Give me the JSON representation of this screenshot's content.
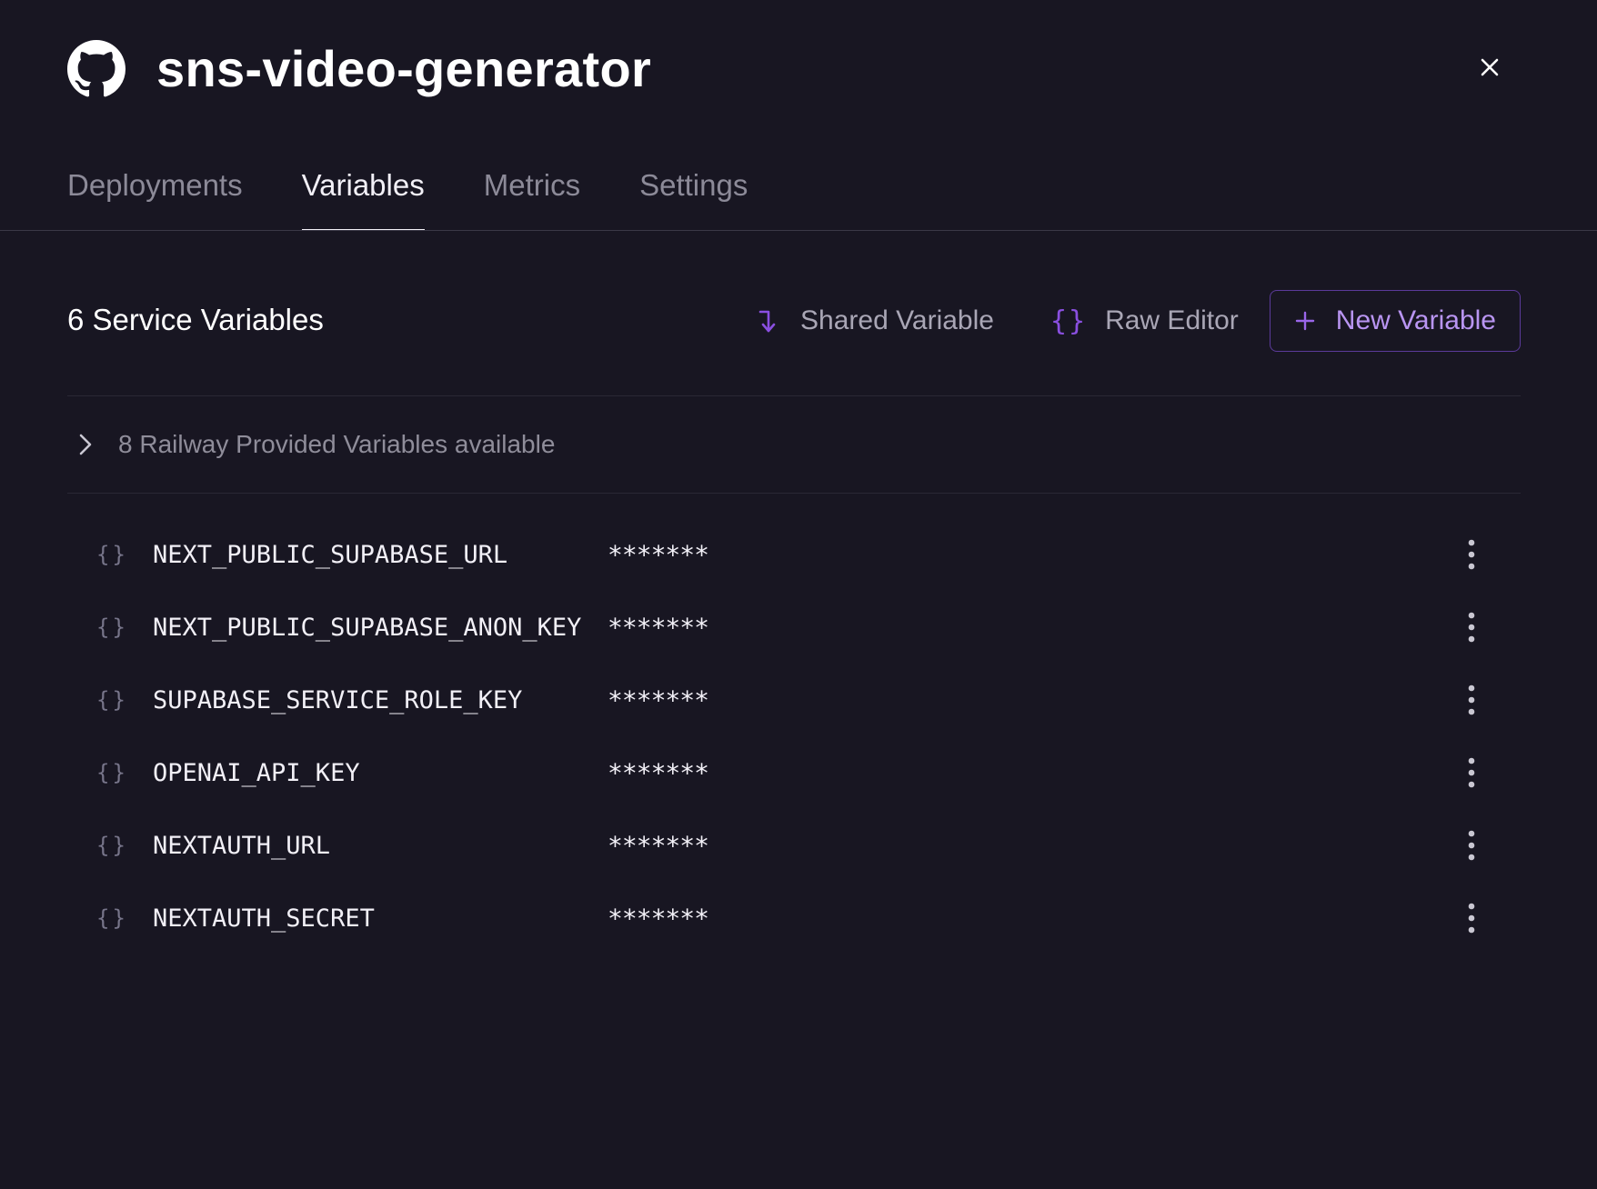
{
  "header": {
    "title": "sns-video-generator",
    "logo_icon": "github-icon",
    "close_icon": "close-icon"
  },
  "tabs": [
    {
      "label": "Deployments",
      "active": false
    },
    {
      "label": "Variables",
      "active": true
    },
    {
      "label": "Metrics",
      "active": false
    },
    {
      "label": "Settings",
      "active": false
    }
  ],
  "toolbar": {
    "section_title": "6 Service Variables",
    "shared_label": "Shared Variable",
    "shared_icon": "arrow-down-right-icon",
    "raw_label": "Raw Editor",
    "raw_icon": "braces-icon",
    "new_label": "New Variable",
    "new_icon": "plus-icon"
  },
  "provided": {
    "label": "8 Railway Provided Variables available",
    "icon": "chevron-right-icon"
  },
  "variables": [
    {
      "name": "NEXT_PUBLIC_SUPABASE_URL",
      "value": "*******"
    },
    {
      "name": "NEXT_PUBLIC_SUPABASE_ANON_KEY",
      "value": "*******"
    },
    {
      "name": "SUPABASE_SERVICE_ROLE_KEY",
      "value": "*******"
    },
    {
      "name": "OPENAI_API_KEY",
      "value": "*******"
    },
    {
      "name": "NEXTAUTH_URL",
      "value": "*******"
    },
    {
      "name": "NEXTAUTH_SECRET",
      "value": "*******"
    }
  ],
  "colors": {
    "background": "#181622",
    "accent": "#8a4fe0",
    "accent_text": "#b995f2",
    "muted_text": "#8c8a98",
    "divider": "#3a3846"
  }
}
